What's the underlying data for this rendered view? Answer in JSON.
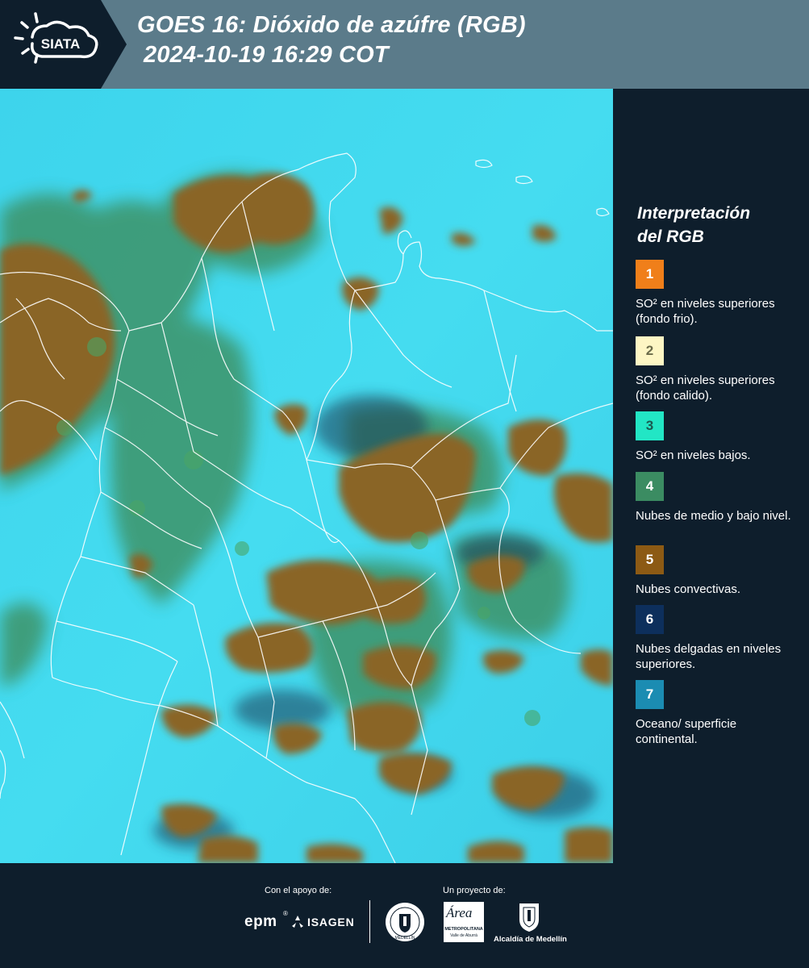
{
  "header": {
    "brand": "SIATA",
    "title_line1": "GOES 16: Dióxido de azúfre (RGB)",
    "title_line2": "2024-10-19 16:29 COT"
  },
  "legend": {
    "title_line1": "Interpretación",
    "title_line2": "del RGB",
    "items": [
      {
        "num": "1",
        "color": "#f07f1a",
        "text_color": "#ffffff",
        "label": "SO² en niveles superiores (fondo frio)."
      },
      {
        "num": "2",
        "color": "#fdf6c4",
        "text_color": "#6b6b4a",
        "label": "SO² en niveles superiores (fondo calido)."
      },
      {
        "num": "3",
        "color": "#22e6c5",
        "text_color": "#1a5a50",
        "label": "SO² en niveles bajos."
      },
      {
        "num": "4",
        "color": "#3b8c62",
        "text_color": "#ffffff",
        "label": "Nubes de medio y bajo nivel."
      },
      {
        "num": "5",
        "color": "#8c5a14",
        "text_color": "#ffffff",
        "label": "Nubes convectivas."
      },
      {
        "num": "6",
        "color": "#0d2f5c",
        "text_color": "#ffffff",
        "label": "Nubes delgadas en niveles superiores."
      },
      {
        "num": "7",
        "color": "#1b8cb2",
        "text_color": "#ffffff",
        "label": "Oceano/ superficie continental."
      }
    ]
  },
  "footer": {
    "support_caption": "Con el apoyo de:",
    "project_caption": "Un proyecto de:",
    "logo_epm": "epm",
    "logo_isagen": "ISAGEN",
    "logo_medellin_seal": "MEDELLÍN",
    "logo_area": "Área",
    "logo_area_sub1": "METROPOLITANA",
    "logo_area_sub2": "Valle de Aburrá",
    "logo_alcaldia": "Alcaldía de Medellín"
  },
  "colors": {
    "header_bg": "#5b7b8a",
    "page_bg": "#0e1e2c",
    "map_background": "#3fd6ee",
    "cloud_convective": "#8a6526",
    "cloud_low": "#3d8a56",
    "border_lines": "#ffffff"
  }
}
